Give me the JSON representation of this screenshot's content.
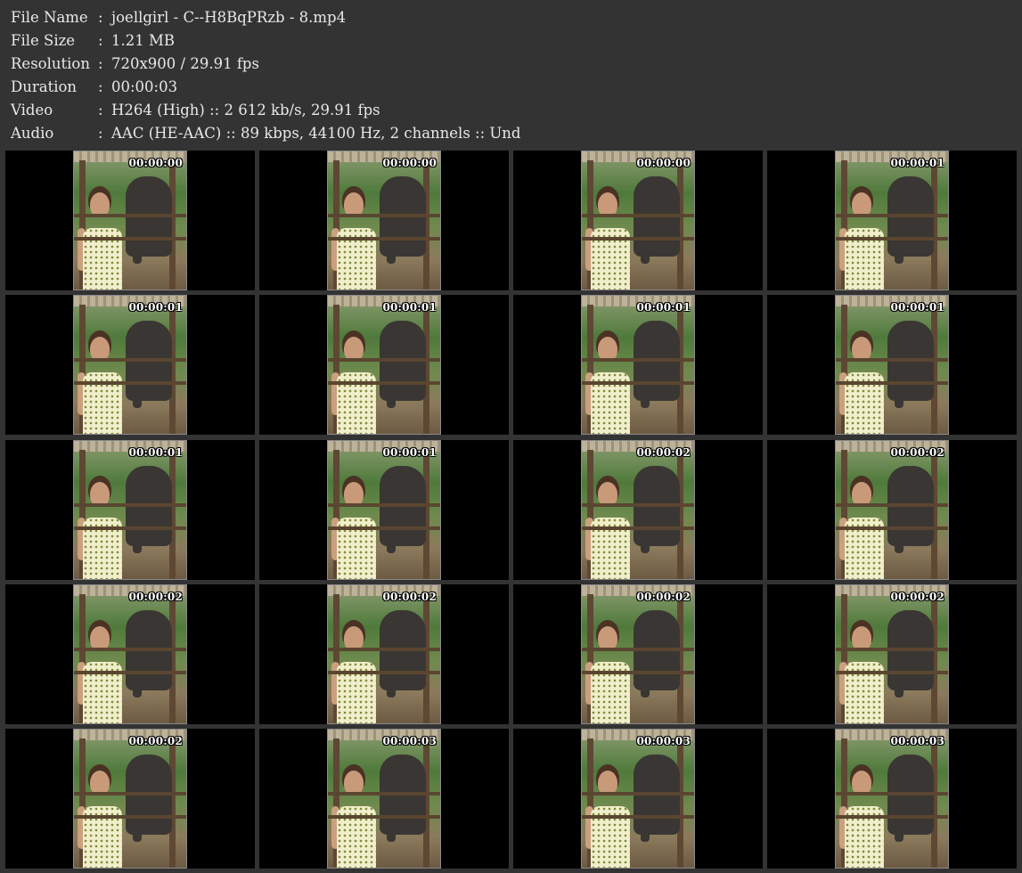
{
  "info": [
    {
      "label": "File Name",
      "sep": ":",
      "value": "joellgirl - C--H8BqPRzb - 8.mp4"
    },
    {
      "label": "File Size",
      "sep": ":",
      "value": "1.21 MB"
    },
    {
      "label": "Resolution",
      "sep": ":",
      "value": "720x900 / 29.91 fps"
    },
    {
      "label": "Duration",
      "sep": ":",
      "value": "00:00:03"
    },
    {
      "label": "Video",
      "sep": ":",
      "value": "H264 (High) :: 2 612 kb/s, 29.91 fps"
    },
    {
      "label": "Audio",
      "sep": ":",
      "value": "AAC (HE-AAC) :: 89 kbps, 44100 Hz, 2 channels :: Und"
    }
  ],
  "thumbnails": [
    {
      "timestamp": "00:00:00"
    },
    {
      "timestamp": "00:00:00"
    },
    {
      "timestamp": "00:00:00"
    },
    {
      "timestamp": "00:00:01"
    },
    {
      "timestamp": "00:00:01"
    },
    {
      "timestamp": "00:00:01"
    },
    {
      "timestamp": "00:00:01"
    },
    {
      "timestamp": "00:00:01"
    },
    {
      "timestamp": "00:00:01"
    },
    {
      "timestamp": "00:00:01"
    },
    {
      "timestamp": "00:00:02"
    },
    {
      "timestamp": "00:00:02"
    },
    {
      "timestamp": "00:00:02"
    },
    {
      "timestamp": "00:00:02"
    },
    {
      "timestamp": "00:00:02"
    },
    {
      "timestamp": "00:00:02"
    },
    {
      "timestamp": "00:00:02"
    },
    {
      "timestamp": "00:00:03"
    },
    {
      "timestamp": "00:00:03"
    },
    {
      "timestamp": "00:00:03"
    }
  ],
  "colors": {
    "background": "#333333",
    "cell": "#000000",
    "text": "#e8e8e8"
  }
}
